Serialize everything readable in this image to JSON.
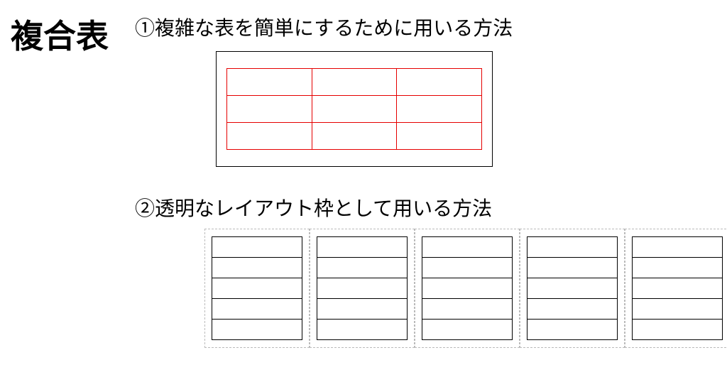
{
  "title": "複合表",
  "section1": {
    "label": "①複雑な表を簡単にするために用いる方法"
  },
  "section2": {
    "label": "②透明なレイアウト枠として用いる方法"
  }
}
